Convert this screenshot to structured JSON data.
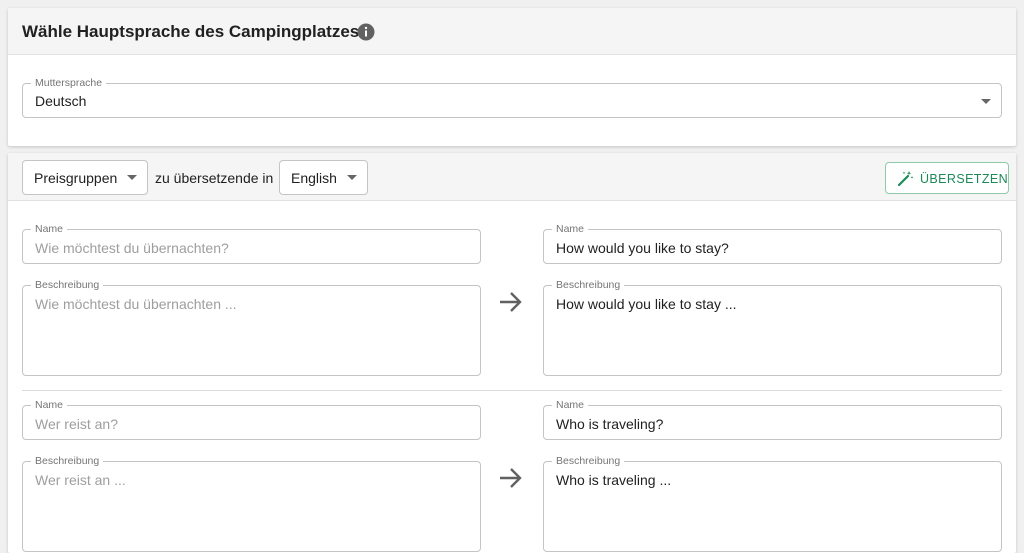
{
  "header": {
    "title": "Wähle Hauptsprache des Campingplatzes"
  },
  "main_language": {
    "label": "Muttersprache",
    "value": "Deutsch"
  },
  "toolbar": {
    "category_select": "Preisgruppen",
    "middle_text": "zu übersetzende in",
    "target_language": "English",
    "translate_button": "ÜBERSETZEN"
  },
  "entries": [
    {
      "source_name_label": "Name",
      "source_name": "Wie möchtest du übernachten?",
      "source_desc_label": "Beschreibung",
      "source_desc": "Wie möchtest du übernachten ...",
      "target_name_label": "Name",
      "target_name": "How would you like to stay?",
      "target_desc_label": "Beschreibung",
      "target_desc": "How would you like to stay ..."
    },
    {
      "source_name_label": "Name",
      "source_name": "Wer reist an?",
      "source_desc_label": "Beschreibung",
      "source_desc": "Wer reist an ...",
      "target_name_label": "Name",
      "target_name": "Who is traveling?",
      "target_desc_label": "Beschreibung",
      "target_desc": "Who is traveling ..."
    }
  ],
  "colors": {
    "accent_green": "#1b8a55",
    "header_bg": "#f5f5f5",
    "border": "#c4c4c4"
  },
  "icons": [
    "info-icon",
    "chevron-down-icon",
    "magic-wand-icon",
    "arrow-right-icon"
  ]
}
